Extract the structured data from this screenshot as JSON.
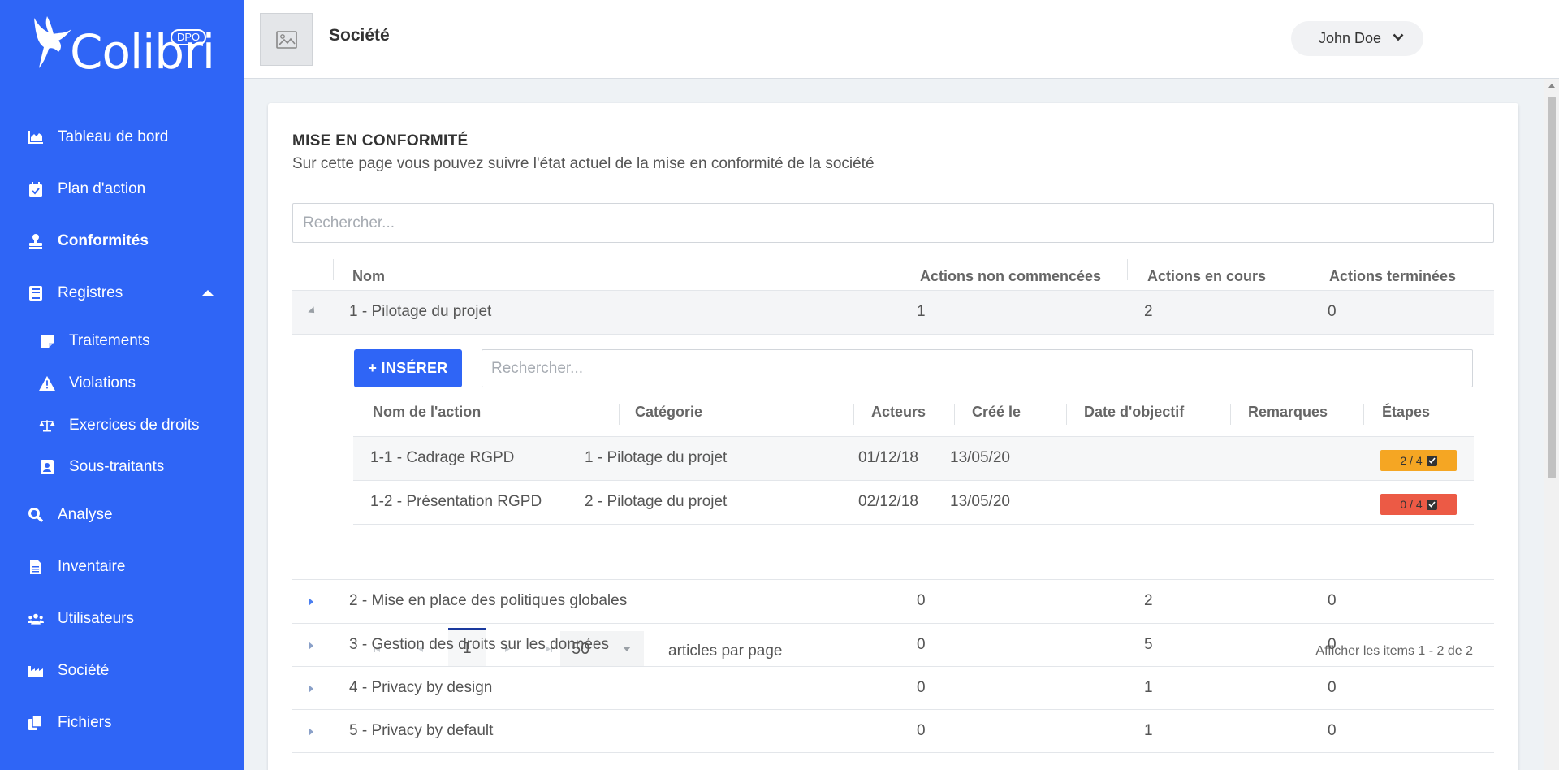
{
  "brand": {
    "name": "Colibri",
    "badge": "DPO"
  },
  "sidebar": {
    "items": [
      {
        "label": "Tableau de bord",
        "icon": "chart-area-icon"
      },
      {
        "label": "Plan d'action",
        "icon": "calendar-check-icon"
      },
      {
        "label": "Conformités",
        "icon": "stamp-icon",
        "active": true
      },
      {
        "label": "Registres",
        "icon": "book-icon",
        "expanded": true
      },
      {
        "label": "Traitements",
        "icon": "sticky-note-icon"
      },
      {
        "label": "Violations",
        "icon": "warning-icon"
      },
      {
        "label": "Exercices de droits",
        "icon": "balance-scale-icon"
      },
      {
        "label": "Sous-traitants",
        "icon": "id-card-icon"
      },
      {
        "label": "Analyse",
        "icon": "search-icon"
      },
      {
        "label": "Inventaire",
        "icon": "file-icon"
      },
      {
        "label": "Utilisateurs",
        "icon": "users-icon"
      },
      {
        "label": "Société",
        "icon": "industry-icon"
      },
      {
        "label": "Fichiers",
        "icon": "copy-icon"
      }
    ]
  },
  "header": {
    "company": "Société",
    "user": "John Doe"
  },
  "page": {
    "title": "MISE EN CONFORMITÉ",
    "subtitle": "Sur cette page vous pouvez suivre l'état actuel de la mise en conformité de la société",
    "search_placeholder": "Rechercher..."
  },
  "table": {
    "columns": [
      "Nom",
      "Actions non commencées",
      "Actions en cours",
      "Actions terminées"
    ],
    "groups": [
      {
        "name": "1 - Pilotage du projet",
        "not_started": "1",
        "in_progress": "2",
        "done": "0"
      },
      {
        "name": "2 - Mise en place des politiques globales",
        "not_started": "0",
        "in_progress": "2",
        "done": "0"
      },
      {
        "name": "3 - Gestion des droits sur les données",
        "not_started": "0",
        "in_progress": "5",
        "done": "0"
      },
      {
        "name": "4 - Privacy by design",
        "not_started": "0",
        "in_progress": "1",
        "done": "0"
      },
      {
        "name": "5 - Privacy by default",
        "not_started": "0",
        "in_progress": "1",
        "done": "0"
      }
    ]
  },
  "detail": {
    "insert_label": "+ INSÉRER",
    "search_placeholder": "Rechercher...",
    "columns": [
      "Nom de l'action",
      "Catégorie",
      "Acteurs",
      "Créé le",
      "Date d'objectif",
      "Remarques",
      "Étapes"
    ],
    "rows": [
      {
        "name": "1-1 - Cadrage RGPD",
        "category": "1 - Pilotage du projet",
        "actors": "",
        "created": "01/12/18",
        "target": "13/05/20",
        "remarks": "",
        "steps": "2 / 4",
        "steps_color": "#f5a623"
      },
      {
        "name": "1-2 - Présentation RGPD",
        "category": "2 - Pilotage du projet",
        "actors": "",
        "created": "02/12/18",
        "target": "13/05/20",
        "remarks": "",
        "steps": "0 / 4",
        "steps_color": "#ec5a45"
      }
    ],
    "pager": {
      "current_page": "1",
      "per_page": "50",
      "per_page_label": "articles par page",
      "info": "Afficher les items 1 - 2 de 2"
    }
  },
  "colors": {
    "sidebar": "#2f65f6",
    "accent": "#2f65f6",
    "badge_warn": "#f5a623",
    "badge_danger": "#ec5a45"
  }
}
